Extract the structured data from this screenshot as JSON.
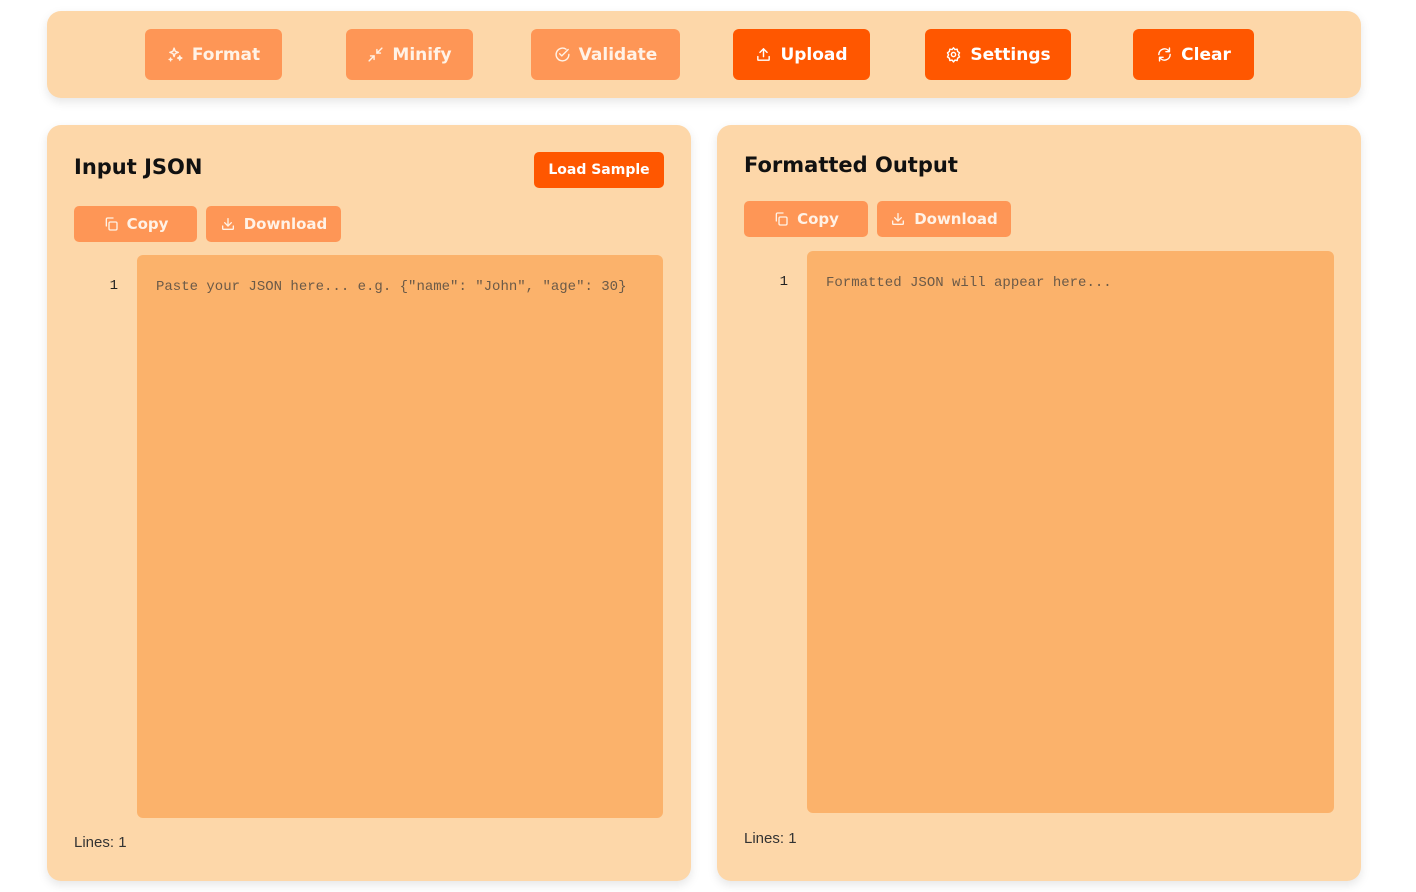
{
  "toolbar": {
    "format_label": "Format",
    "minify_label": "Minify",
    "validate_label": "Validate",
    "upload_label": "Upload",
    "settings_label": "Settings",
    "clear_label": "Clear"
  },
  "input_panel": {
    "title": "Input JSON",
    "load_sample_label": "Load Sample",
    "copy_label": "Copy",
    "download_label": "Download",
    "line_number": "1",
    "placeholder": "Paste your JSON here... e.g. {\"name\": \"John\", \"age\": 30}",
    "lines_status": "Lines: 1"
  },
  "output_panel": {
    "title": "Formatted Output",
    "copy_label": "Copy",
    "download_label": "Download",
    "line_number": "1",
    "placeholder": "Formatted JSON will appear here...",
    "lines_status": "Lines: 1"
  },
  "colors": {
    "accent": "#ff5700",
    "accent_light": "#fe9656",
    "panel_bg": "#fdd7a9",
    "editor_bg": "#fbb26b"
  }
}
